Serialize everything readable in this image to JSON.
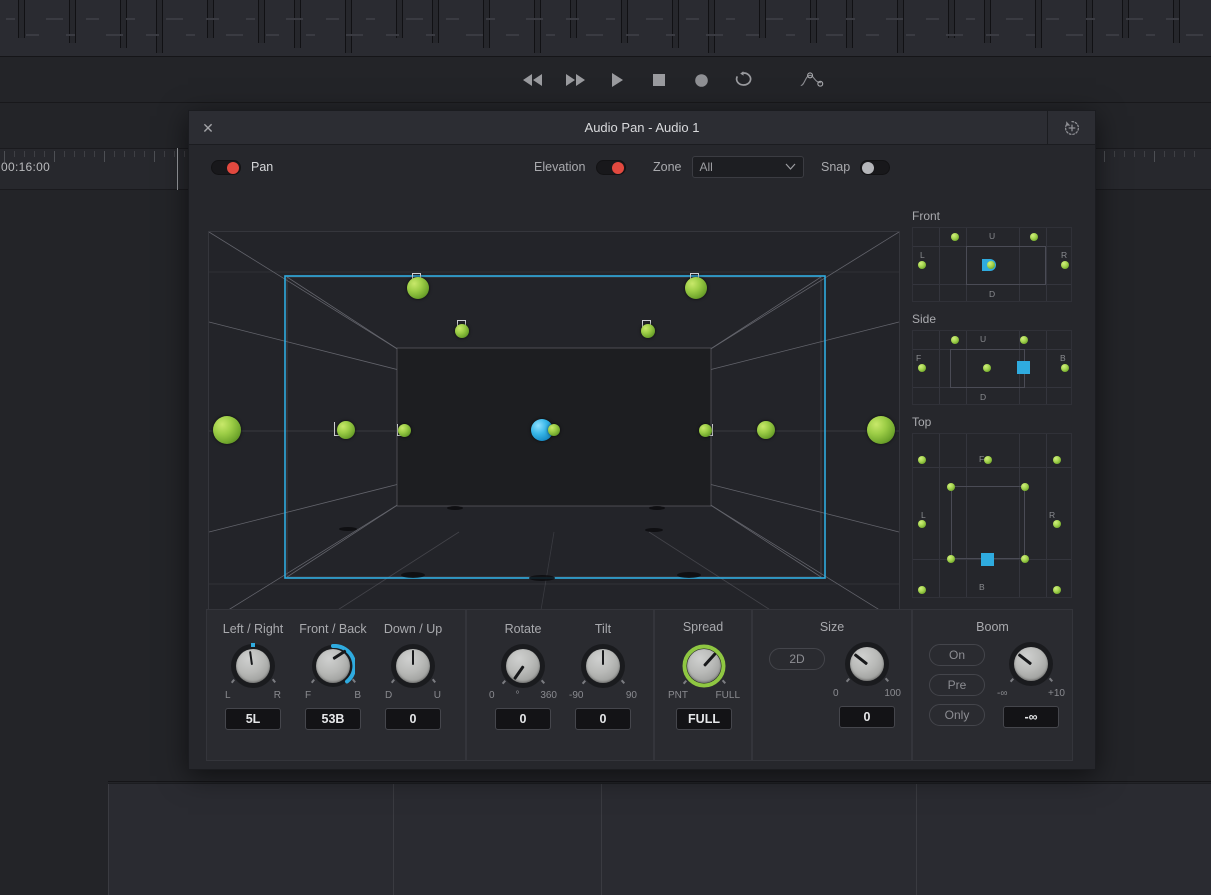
{
  "app": {
    "timecode": "00:16:00"
  },
  "transport": {
    "buttons": [
      {
        "name": "rewind-button",
        "icon": "rewind-icon"
      },
      {
        "name": "fast-forward-button",
        "icon": "fast-forward-icon"
      },
      {
        "name": "play-button",
        "icon": "play-icon"
      },
      {
        "name": "stop-button",
        "icon": "stop-icon"
      },
      {
        "name": "record-button",
        "icon": "record-icon"
      },
      {
        "name": "loop-button",
        "icon": "loop-icon"
      },
      {
        "name": "keyframe-button",
        "icon": "keyframe-curve-icon"
      }
    ]
  },
  "dialog": {
    "title": "Audio Pan - Audio 1",
    "close_label": "✕",
    "reset_icon": "reset-history-icon"
  },
  "options": {
    "pan_label": "Pan",
    "pan_enabled": "on",
    "elevation_label": "Elevation",
    "elevation_enabled": "on",
    "zone_label": "Zone",
    "zone_value": "All",
    "zone_chevron": "⌄",
    "snap_label": "Snap",
    "snap_enabled": "off"
  },
  "mini_views": [
    {
      "title": "Front",
      "axis_labels": [
        "U",
        "D",
        "L",
        "R"
      ]
    },
    {
      "title": "Side",
      "axis_labels": [
        "U",
        "D",
        "F",
        "B"
      ]
    },
    {
      "title": "Top",
      "axis_labels": [
        "F",
        "B",
        "L",
        "R"
      ]
    }
  ],
  "controls": {
    "position_group": {
      "knobs": [
        {
          "name": "Left / Right",
          "min": "L",
          "max": "R",
          "value": "5L"
        },
        {
          "name": "Front / Back",
          "min": "F",
          "max": "B",
          "value": "53B"
        },
        {
          "name": "Down / Up",
          "min": "D",
          "max": "U",
          "value": "0"
        }
      ]
    },
    "rotate_group": {
      "knobs": [
        {
          "name": "Rotate",
          "min": "0",
          "mid": "°",
          "max": "360",
          "value": "0"
        },
        {
          "name": "Tilt",
          "min": "-90",
          "mid": "",
          "max": "90",
          "value": "0"
        }
      ]
    },
    "spread_group": {
      "title": "Spread",
      "min": "PNT",
      "max": "FULL",
      "value": "FULL"
    },
    "size_group": {
      "title": "Size",
      "mode_button": "2D",
      "min": "0",
      "max": "100",
      "value": "0"
    },
    "boom_group": {
      "title": "Boom",
      "buttons": [
        "On",
        "Pre",
        "Only"
      ],
      "min": "-∞",
      "max": "+10",
      "value": "-∞"
    }
  },
  "colors": {
    "accent_blue": "#2fabdf",
    "accent_green": "#8fc742",
    "accent_red": "#e2493f",
    "panel_bg": "#26272c",
    "window_bg": "#232428"
  }
}
